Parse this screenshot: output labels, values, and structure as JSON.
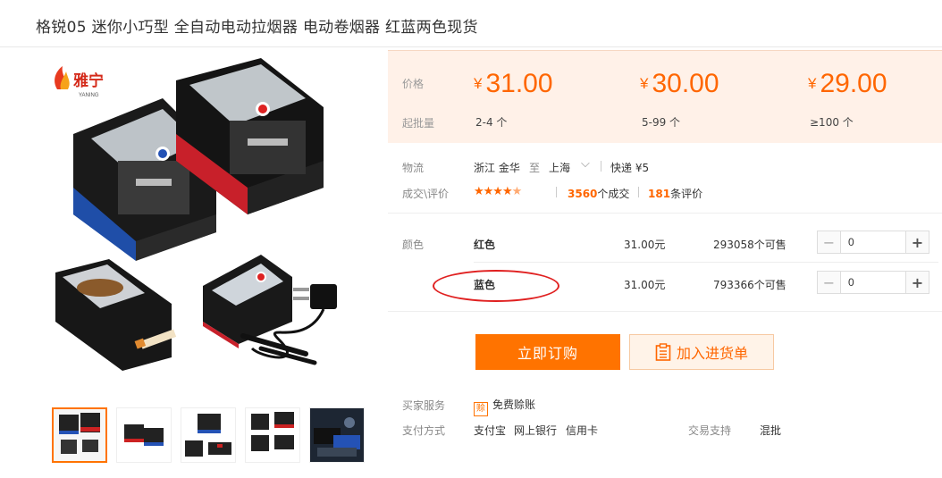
{
  "product": {
    "title": "格锐05 迷你小巧型 全自动电动拉烟器 电动卷烟器 红蓝两色现货"
  },
  "brand_logo": {
    "name": "雅宁",
    "sub": "YANING"
  },
  "price_box": {
    "price_label": "价格",
    "moq_label": "起批量",
    "currency": "¥",
    "tiers": [
      {
        "price": "31.00",
        "qty": "2-4 个"
      },
      {
        "price": "30.00",
        "qty": "5-99 个"
      },
      {
        "price": "29.00",
        "qty": "≥100 个"
      }
    ]
  },
  "logistics": {
    "label": "物流",
    "from": "浙江 金华",
    "to_word": "至",
    "to": "上海",
    "express": "快递 ¥5"
  },
  "reviews": {
    "label": "成交\\评价",
    "deals_count": "3560",
    "deals_text": "个成交",
    "review_count": "181",
    "review_text": "条评价"
  },
  "color": {
    "label": "颜色",
    "options": [
      {
        "name": "红色",
        "price": "31.00元",
        "stock": "293058个可售",
        "qty": "0"
      },
      {
        "name": "蓝色",
        "price": "31.00元",
        "stock": "793366个可售",
        "qty": "0"
      }
    ]
  },
  "actions": {
    "buy_now": "立即订购",
    "add_to_cart": "加入进货单"
  },
  "services": {
    "buyer_label": "买家服务",
    "buyer_badge": "赊",
    "buyer_value": "免费赊账",
    "pay_label": "支付方式",
    "pay_methods": [
      "支付宝",
      "网上银行",
      "信用卡"
    ],
    "trade_label": "交易支持",
    "trade_value": "混批"
  },
  "colors": {
    "accent": "#ff7300",
    "price": "#ff6600",
    "annotation": "#e02020"
  }
}
